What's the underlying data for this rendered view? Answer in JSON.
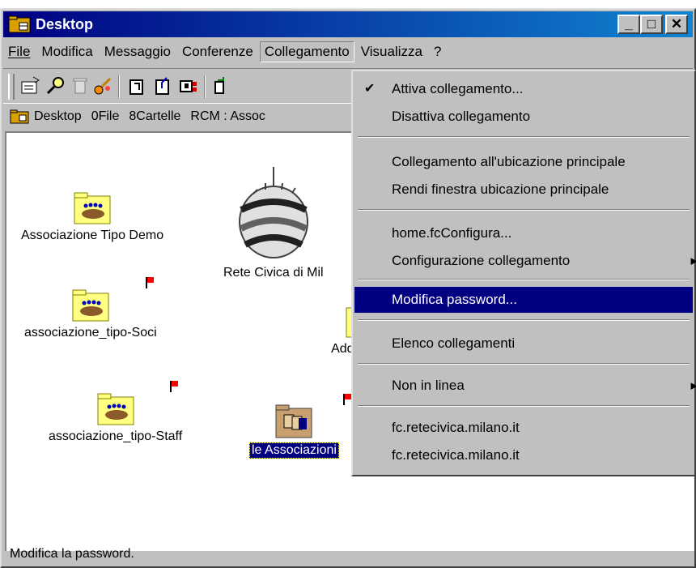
{
  "window": {
    "title": "Desktop"
  },
  "caption_buttons": {
    "minimize": "_",
    "maximize": "□",
    "close": "✕"
  },
  "menubar": [
    {
      "label": "File"
    },
    {
      "label": "Modifica"
    },
    {
      "label": "Messaggio"
    },
    {
      "label": "Conferenze"
    },
    {
      "label": "Collegamento"
    },
    {
      "label": "Visualizza"
    },
    {
      "label": "?"
    }
  ],
  "toolbar": {
    "icons": [
      "new-message-icon",
      "search-icon",
      "trash-icon",
      "keys-icon",
      "document-icon",
      "document-up-icon",
      "cards-icon",
      "user-icon"
    ]
  },
  "addressbar": {
    "location": "Desktop",
    "files": "0File",
    "folders": "8Cartelle",
    "rcm": "RCM : Assoc"
  },
  "icons": [
    {
      "label": "Associazione Tipo Demo"
    },
    {
      "label": "associazione_tipo-Soci"
    },
    {
      "label": "associazione_tipo-Staff"
    },
    {
      "label": "Rete Civica di Mil"
    },
    {
      "label": "Addr"
    },
    {
      "label": "le Associazioni"
    }
  ],
  "dropdown": {
    "items": [
      {
        "label": "Attiva collegamento...",
        "checked": true
      },
      {
        "label": "Disattiva collegamento"
      },
      {
        "label": "Collegamento all'ubicazione principale"
      },
      {
        "label": "Rendi finestra ubicazione principale"
      },
      {
        "label": "home.fcConfigura..."
      },
      {
        "label": "Configurazione collegamento"
      },
      {
        "label": "Modifica password..."
      },
      {
        "label": "Elenco collegamenti"
      },
      {
        "label": "Non in linea"
      },
      {
        "label": "fc.retecivica.milano.it"
      },
      {
        "label": "fc.retecivica.milano.it"
      }
    ]
  },
  "status": {
    "text": "Modifica la password."
  },
  "colors": {
    "title_start": "#000080",
    "title_end": "#1084d0",
    "selection": "#000080",
    "face": "#c0c0c0",
    "flag": "#ff0000"
  }
}
